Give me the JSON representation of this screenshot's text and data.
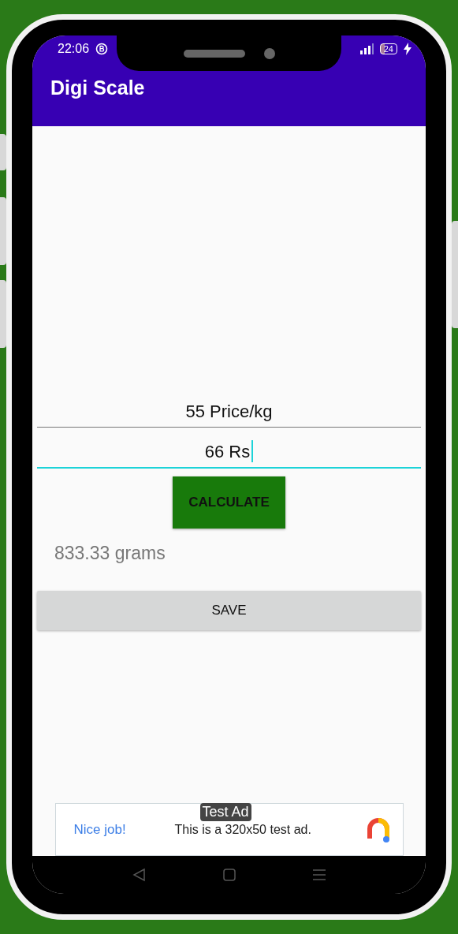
{
  "status_bar": {
    "time": "22:06",
    "battery": "24"
  },
  "app_bar": {
    "title": "Digi Scale"
  },
  "fields": [
    {
      "value": "55 Price/kg",
      "focused": false
    },
    {
      "value": "66 Rs",
      "focused": true
    }
  ],
  "calculate_button": "CALCULATE",
  "result": "833.33 grams",
  "save_button": "SAVE",
  "ad": {
    "badge": "Test Ad",
    "headline": "Nice job!",
    "text": "This is a 320x50 test ad."
  }
}
